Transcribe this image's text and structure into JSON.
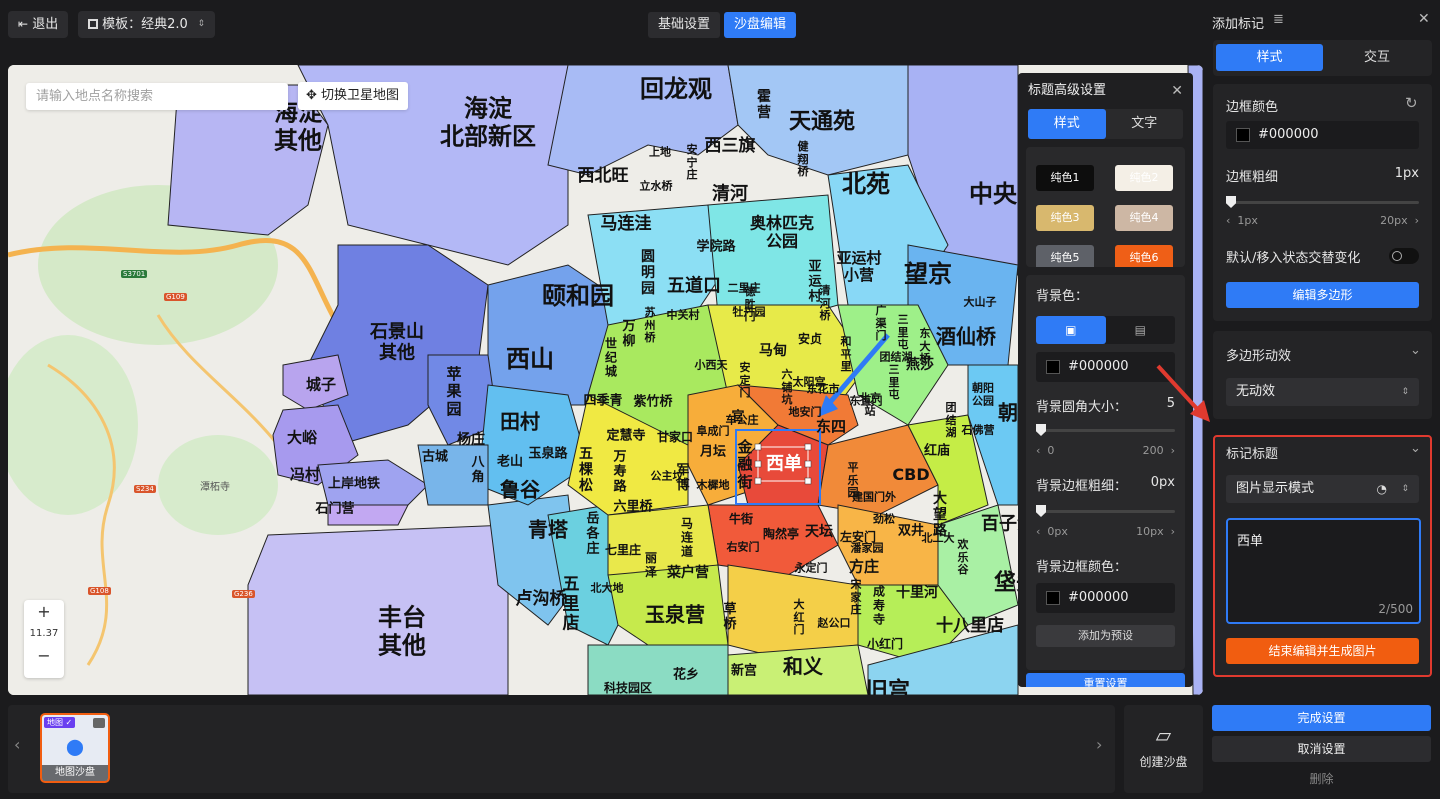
{
  "topbar": {
    "exit_label": "退出",
    "template_label": "模板：经典2.0",
    "tabs": [
      {
        "label": "基础设置"
      },
      {
        "label": "沙盘编辑"
      }
    ]
  },
  "map": {
    "search_placeholder": "请输入地点名称搜索",
    "satellite_button": "切换卫星地图",
    "zoom_level": "11.37",
    "zoom_in": "+",
    "zoom_out": "−",
    "basemap_labels": [
      "潭柘寺",
      "S3701",
      "G109",
      "G108",
      "S234",
      "G236"
    ],
    "regions": [
      {
        "name": "海淀\n其他",
        "size": 24
      },
      {
        "name": "海淀\n北部新区",
        "size": 24
      },
      {
        "name": "回龙观",
        "size": 24
      },
      {
        "name": "霍\n营",
        "size": 14
      },
      {
        "name": "天通苑",
        "size": 22
      },
      {
        "name": "西三旗",
        "size": 17
      },
      {
        "name": "西北旺",
        "size": 17
      },
      {
        "name": "清河",
        "size": 18
      },
      {
        "name": "北苑",
        "size": 24
      },
      {
        "name": "中央",
        "size": 24
      },
      {
        "name": "马连洼",
        "size": 17
      },
      {
        "name": "奥林匹克\n公园",
        "size": 16
      },
      {
        "name": "亚运村\n小营",
        "size": 15
      },
      {
        "name": "望京",
        "size": 24
      },
      {
        "name": "颐和园",
        "size": 24
      },
      {
        "name": "五道口",
        "size": 18
      },
      {
        "name": "圆\n明\n园",
        "size": 14
      },
      {
        "name": "学院路",
        "size": 13
      },
      {
        "name": "石景山\n其他",
        "size": 18
      },
      {
        "name": "西山",
        "size": 24
      },
      {
        "name": "苹\n果\n园",
        "size": 15
      },
      {
        "name": "城子",
        "size": 15
      },
      {
        "name": "大峪",
        "size": 15
      },
      {
        "name": "冯村",
        "size": 15
      },
      {
        "name": "上岸地铁",
        "size": 13
      },
      {
        "name": "石门营",
        "size": 13
      },
      {
        "name": "田村",
        "size": 20
      },
      {
        "name": "杨庄",
        "size": 14
      },
      {
        "name": "古城",
        "size": 13
      },
      {
        "name": "八\n角",
        "size": 13
      },
      {
        "name": "老山",
        "size": 13
      },
      {
        "name": "玉泉路",
        "size": 13
      },
      {
        "name": "鲁谷",
        "size": 20
      },
      {
        "name": "青塔",
        "size": 20
      },
      {
        "name": "五\n棵\n松",
        "size": 14
      },
      {
        "name": "岳\n各\n庄",
        "size": 13
      },
      {
        "name": "卢沟桥",
        "size": 17
      },
      {
        "name": "五\n里\n店",
        "size": 17
      },
      {
        "name": "丰台\n其他",
        "size": 24
      },
      {
        "name": "玉泉营",
        "size": 20
      },
      {
        "name": "草\n桥",
        "size": 13
      },
      {
        "name": "菜户营",
        "size": 14
      },
      {
        "name": "新宫",
        "size": 13
      },
      {
        "name": "和义",
        "size": 20
      },
      {
        "name": "旧宫",
        "size": 22
      },
      {
        "name": "花乡",
        "size": 13
      },
      {
        "name": "科技园区",
        "size": 12
      },
      {
        "name": "西单",
        "size": 18
      },
      {
        "name": "金\n融\n街",
        "size": 15
      },
      {
        "name": "东四",
        "size": 15
      },
      {
        "name": "CBD",
        "size": 16
      },
      {
        "name": "大\n望\n路",
        "size": 14
      },
      {
        "name": "朝青",
        "size": 20
      },
      {
        "name": "酒仙桥",
        "size": 20
      },
      {
        "name": "燕莎",
        "size": 14
      },
      {
        "name": "百子湾",
        "size": 18
      },
      {
        "name": "垡头",
        "size": 22
      },
      {
        "name": "十八里店",
        "size": 17
      },
      {
        "name": "十里河",
        "size": 14
      },
      {
        "name": "方庄",
        "size": 15
      },
      {
        "name": "天坛",
        "size": 14
      },
      {
        "name": "陶然亭",
        "size": 12
      },
      {
        "name": "马甸",
        "size": 14
      },
      {
        "name": "安贞",
        "size": 12
      },
      {
        "name": "月坛",
        "size": 13
      },
      {
        "name": "甘家口",
        "size": 12
      },
      {
        "name": "紫竹桥",
        "size": 13
      },
      {
        "name": "四季青",
        "size": 13
      },
      {
        "name": "定慧寺",
        "size": 13
      },
      {
        "name": "万\n寿\n路",
        "size": 13
      },
      {
        "name": "军\n博",
        "size": 13
      },
      {
        "name": "六里桥",
        "size": 13
      },
      {
        "name": "牛街",
        "size": 12
      },
      {
        "name": "左安门",
        "size": 12
      },
      {
        "name": "红庙",
        "size": 13
      },
      {
        "name": "双井",
        "size": 13
      },
      {
        "name": "成\n寿\n寺",
        "size": 12
      },
      {
        "name": "小红门",
        "size": 12
      },
      {
        "name": "七里庄",
        "size": 12
      },
      {
        "name": "马\n连\n道",
        "size": 12
      },
      {
        "name": "丽\n泽",
        "size": 12
      },
      {
        "name": "北大地",
        "size": 11
      },
      {
        "name": "万\n柳",
        "size": 13
      },
      {
        "name": "世\n纪\n城",
        "size": 12
      },
      {
        "name": "苏\n州\n桥",
        "size": 11
      },
      {
        "name": "中关村",
        "size": 11
      },
      {
        "name": "二里庄",
        "size": 11
      },
      {
        "name": "牡丹园",
        "size": 11
      },
      {
        "name": "亚\n运\n村",
        "size": 13
      },
      {
        "name": "北京\n站",
        "size": 11
      },
      {
        "name": "三\n里\n屯",
        "size": 11
      },
      {
        "name": "东直门",
        "size": 11
      },
      {
        "name": "团结湖",
        "size": 11
      },
      {
        "name": "大山子",
        "size": 11
      },
      {
        "name": "小西天",
        "size": 11
      },
      {
        "name": "官",
        "size": 13
      },
      {
        "name": "阜成门",
        "size": 11
      },
      {
        "name": "车公庄",
        "size": 11
      },
      {
        "name": "地安门",
        "size": 11
      },
      {
        "name": "六\n铺\n坑",
        "size": 11
      },
      {
        "name": "和\n平\n里",
        "size": 11
      },
      {
        "name": "永定门",
        "size": 11
      },
      {
        "name": "木樨地",
        "size": 11
      },
      {
        "name": "公主坟",
        "size": 11
      },
      {
        "name": "潘家园",
        "size": 11
      },
      {
        "name": "劲松",
        "size": 11
      },
      {
        "name": "北工大",
        "size": 11
      },
      {
        "name": "宋\n家\n庄",
        "size": 11
      },
      {
        "name": "欢\n乐\n谷",
        "size": 11
      },
      {
        "name": "赵公口",
        "size": 11
      },
      {
        "name": "大\n红\n门",
        "size": 11
      },
      {
        "name": "右安门",
        "size": 11
      },
      {
        "name": "石佛营",
        "size": 11
      },
      {
        "name": "朝阳\n公园",
        "size": 11
      },
      {
        "name": "三\n里\n屯",
        "size": 11
      },
      {
        "name": "东\n大\n桥",
        "size": 11
      },
      {
        "name": "广\n渠\n门",
        "size": 11
      },
      {
        "name": "太阳宫",
        "size": 11
      },
      {
        "name": "安\n定\n门",
        "size": 11
      },
      {
        "name": "德\n胜\n门",
        "size": 11
      },
      {
        "name": "健\n翔\n桥",
        "size": 11
      },
      {
        "name": "立水桥",
        "size": 11
      },
      {
        "name": "上地",
        "size": 11
      },
      {
        "name": "安\n宁\n庄",
        "size": 11
      },
      {
        "name": "清\n河\n桥",
        "size": 11
      },
      {
        "name": "平\n乐\n园",
        "size": 11
      },
      {
        "name": "建国门外",
        "size": 11
      },
      {
        "name": "东花市",
        "size": 11
      },
      {
        "name": "团\n结\n湖",
        "size": 11
      },
      {
        "name": "酒\n仙\n桥",
        "size": 11
      }
    ]
  },
  "adv_panel": {
    "title": "标题高级设置",
    "tabs": [
      {
        "label": "样式"
      },
      {
        "label": "文字"
      }
    ],
    "presets": [
      {
        "label": "纯色1",
        "bg": "#0d0d0d",
        "fg": "#ffffff"
      },
      {
        "label": "纯色2",
        "bg": "#f4efe6",
        "fg": "#ffffff"
      },
      {
        "label": "纯色3",
        "bg": "#d8b86e",
        "fg": "#ffffff"
      },
      {
        "label": "纯色4",
        "bg": "#cdb7a4",
        "fg": "#ffffff"
      },
      {
        "label": "纯色5",
        "bg": "#5e6168",
        "fg": "#ffffff"
      },
      {
        "label": "纯色6",
        "bg": "#ef5f17",
        "fg": "#ffffff"
      }
    ],
    "bg_color_label": "背景色：",
    "bg_color_value": "#000000",
    "radius_label": "背景圆角大小：",
    "radius_value": "5",
    "radius_min": "0",
    "radius_max": "200",
    "border_width_label": "背景边框粗细：",
    "border_width_value": "0px",
    "border_width_min": "0px",
    "border_width_max": "10px",
    "border_color_label": "背景边框颜色：",
    "border_color_value": "#000000",
    "add_preset": "添加为预设",
    "reset": "重置设置"
  },
  "thumbs": {
    "items": [
      {
        "label": "地图沙盘",
        "tag": "地图"
      }
    ],
    "create_label": "创建沙盘"
  },
  "right_panel": {
    "title": "添加标记",
    "tabs": [
      {
        "label": "样式"
      },
      {
        "label": "交互"
      }
    ],
    "border_color_label": "边框颜色",
    "border_color_value": "#000000",
    "border_width_label": "边框粗细",
    "border_width_value": "1px",
    "border_min": "1px",
    "border_max": "20px",
    "toggle_label": "默认/移入状态交替变化",
    "edit_polygon": "编辑多边形",
    "anim_title": "多边形动效",
    "anim_value": "无动效",
    "marker_title": "标记标题",
    "display_mode": "图片显示模式",
    "title_text": "西单",
    "char_count": "2/500",
    "finish_edit": "结束编辑并生成图片",
    "done": "完成设置",
    "cancel": "取消设置",
    "delete": "删除"
  },
  "colors": {
    "accent": "#2f7bf6",
    "orange": "#f15d10",
    "highlight_border": "#e03a2f"
  }
}
